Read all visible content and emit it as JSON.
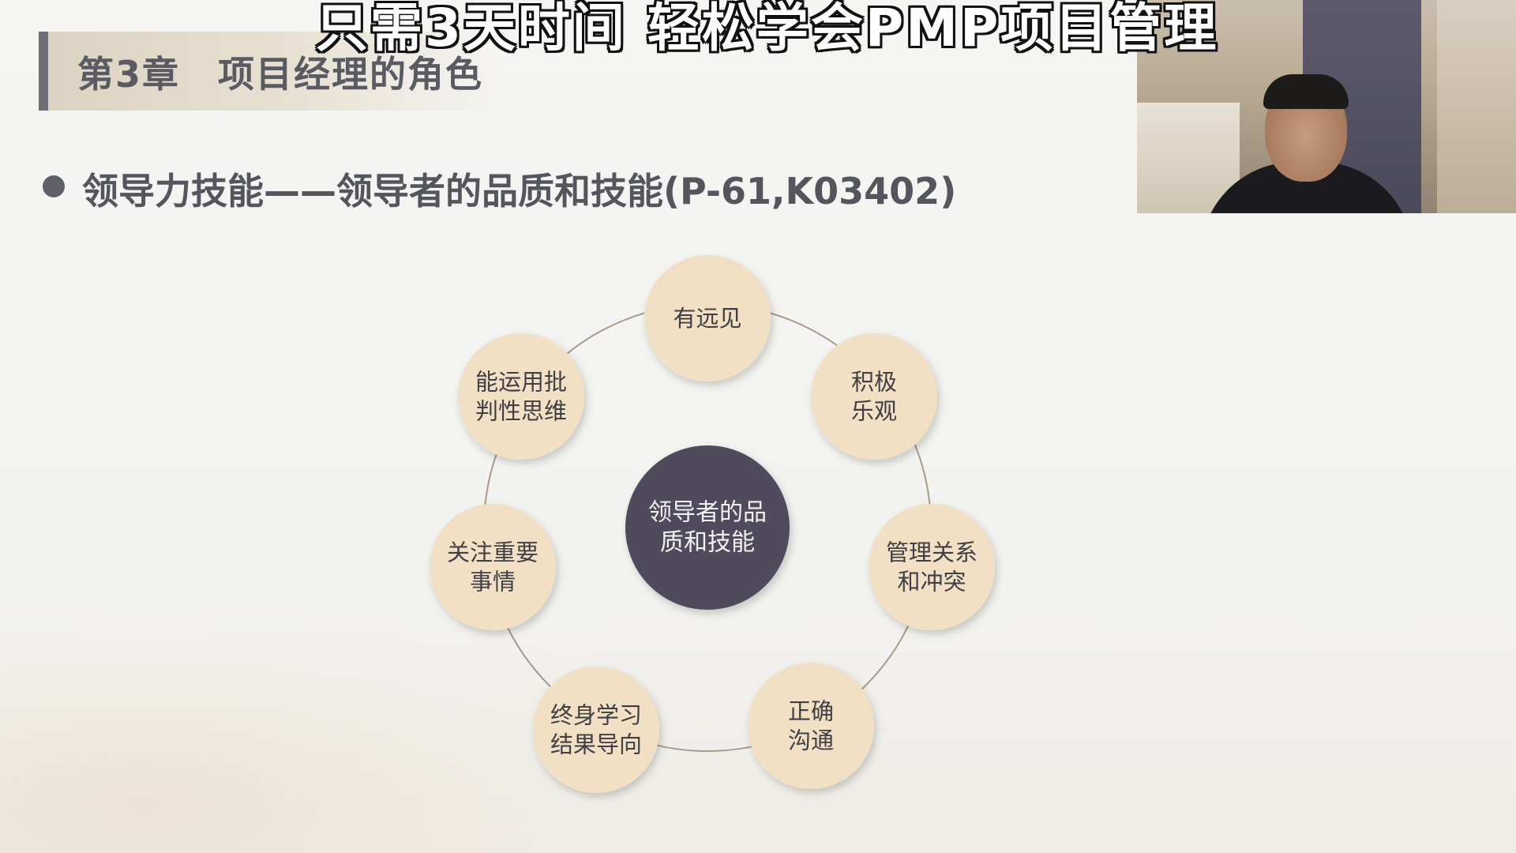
{
  "banner": {
    "title": "只需3天时间 轻松学会PMP项目管理"
  },
  "slide": {
    "chapter_title": "第3章　项目经理的角色",
    "bullet_heading": "领导力技能——领导者的品质和技能(P-61,K03402)"
  },
  "diagram": {
    "center": {
      "lines": [
        "领导者的品",
        "质和技能"
      ]
    },
    "nodes": [
      {
        "lines": [
          "有远见"
        ]
      },
      {
        "lines": [
          "积极",
          "乐观"
        ]
      },
      {
        "lines": [
          "管理关系",
          "和冲突"
        ]
      },
      {
        "lines": [
          "正确",
          "沟通"
        ]
      },
      {
        "lines": [
          "终身学习",
          "结果导向"
        ]
      },
      {
        "lines": [
          "关注重要",
          "事情"
        ]
      },
      {
        "lines": [
          "能运用批",
          "判性思维"
        ]
      }
    ]
  },
  "colors": {
    "node_fill": "#f1e0c4",
    "center_fill": "#4f4c5b",
    "ring_stroke": "#a89a88",
    "accent": "#6f6f78"
  },
  "icons": {
    "bullet": "bullet-dot-icon"
  }
}
